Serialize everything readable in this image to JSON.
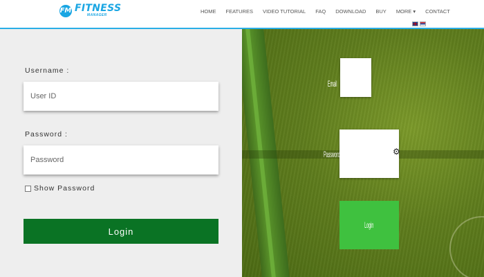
{
  "logo": {
    "badge": "FM",
    "title": "FITNESS",
    "subtitle": "MANAGER"
  },
  "nav": [
    {
      "label": "HOME"
    },
    {
      "label": "FEATURES"
    },
    {
      "label": "VIDEO TUTORIAL"
    },
    {
      "label": "FAQ"
    },
    {
      "label": "DOWNLOAD"
    },
    {
      "label": "BUY"
    },
    {
      "label": "MORE ▾"
    },
    {
      "label": "CONTACT"
    }
  ],
  "login_form": {
    "username_label": "Username :",
    "username_placeholder": "User ID",
    "password_label": "Password :",
    "password_placeholder": "Password",
    "show_password_label": "Show Password",
    "show_password_checked": false,
    "login_label": "Login"
  },
  "mirror_form": {
    "email_label": "Email",
    "password_label": "Password",
    "login_label": "Login"
  },
  "colors": {
    "accent": "#29aee6",
    "brand": "#1aa6e3",
    "login_button": "#0a7324",
    "mirror_button": "#3fc13f",
    "left_panel_bg": "#eeeeee"
  }
}
